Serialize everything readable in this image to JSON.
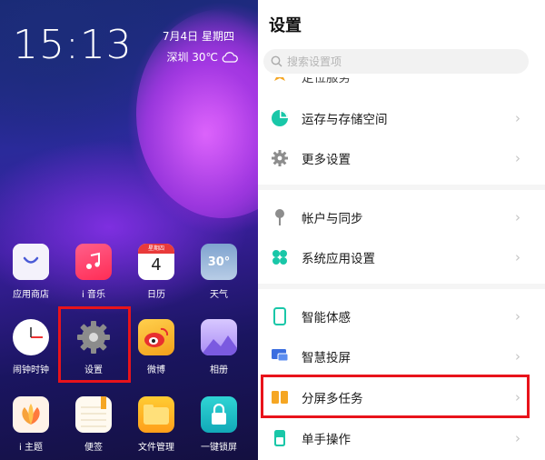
{
  "home": {
    "time": "15:13",
    "date": "7月4日  星期四",
    "weather": {
      "city_temp": "深圳 30℃",
      "icon": "cloud-icon"
    },
    "apps": [
      {
        "label": "应用商店",
        "icon": "app-store-icon",
        "color": "#3c4a8c"
      },
      {
        "label": "i 音乐",
        "icon": "music-icon",
        "color": "#ff3f6a"
      },
      {
        "label": "日历",
        "icon": "calendar-icon",
        "color": "#ffffff",
        "text": "4",
        "badge": "星期四"
      },
      {
        "label": "天气",
        "icon": "weather-icon",
        "color": "#9bb6d6",
        "text": "30°"
      },
      {
        "label": "闹钟时钟",
        "icon": "clock-icon",
        "color": "#ffffff"
      },
      {
        "label": "设置",
        "icon": "settings-gear-icon",
        "color": "#8a8a8a"
      },
      {
        "label": "微博",
        "icon": "weibo-icon",
        "color": "#f6a623"
      },
      {
        "label": "相册",
        "icon": "photo-album-icon",
        "color": "#b9a3ff"
      },
      {
        "label": "i 主题",
        "icon": "theme-icon",
        "color": "#ffe3c8"
      },
      {
        "label": "便签",
        "icon": "notes-icon",
        "color": "#fff7e0"
      },
      {
        "label": "文件管理",
        "icon": "file-manager-icon",
        "color": "#ffb21a"
      },
      {
        "label": "一键锁屏",
        "icon": "lock-icon",
        "color": "#17c1c8"
      }
    ]
  },
  "settings": {
    "title": "设置",
    "search_placeholder": "搜索设置项",
    "partial_item": "定位服务",
    "items": [
      {
        "label": "运存与存储空间",
        "icon": "storage-pie-icon",
        "color": "#19c7a8"
      },
      {
        "label": "更多设置",
        "icon": "gear-icon",
        "color": "#8d8d8d"
      },
      {
        "label": "帐户与同步",
        "icon": "pin-icon",
        "color": "#8d8d8d"
      },
      {
        "label": "系统应用设置",
        "icon": "four-leaf-icon",
        "color": "#19c7a8"
      },
      {
        "label": "智能体感",
        "icon": "phone-motion-icon",
        "color": "#19c7a8"
      },
      {
        "label": "智慧投屏",
        "icon": "cast-screen-icon",
        "color": "#3a6de0"
      },
      {
        "label": "分屏多任务",
        "icon": "split-screen-icon",
        "color": "#f5a623"
      },
      {
        "label": "单手操作",
        "icon": "one-hand-icon",
        "color": "#19c7a8"
      }
    ],
    "chevron": "›"
  }
}
